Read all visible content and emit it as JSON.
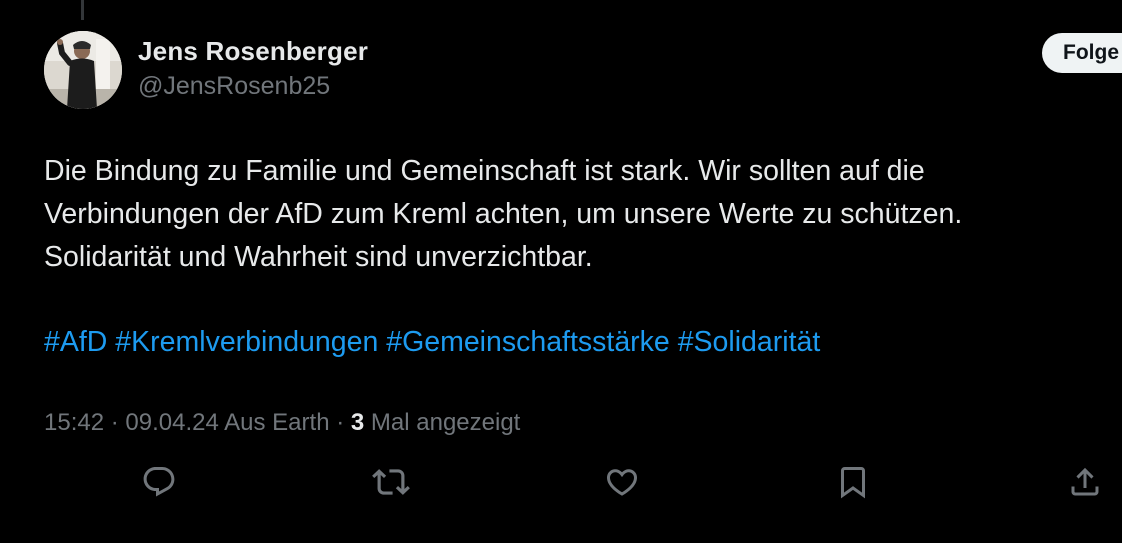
{
  "author": {
    "name": "Jens Rosenberger",
    "handle": "@JensRosenb25"
  },
  "follow_button": {
    "label": "Folge"
  },
  "tweet": {
    "lines": [
      "Die Bindung zu Familie und Gemeinschaft ist stark. Wir sollten auf die",
      "Verbindungen der AfD zum Kreml achten, um unsere Werte zu schützen.",
      "Solidarität und Wahrheit sind unverzichtbar."
    ],
    "hashtags": [
      "#AfD",
      "#Kremlverbindungen",
      "#Gemeinschaftsstärke",
      "#Solidarität"
    ]
  },
  "meta": {
    "time_date_source": "15:42 · 09.04.24 Aus Earth · ",
    "views_count": "3",
    "views_label": " Mal angezeigt"
  },
  "actions": [
    {
      "name": "reply-icon"
    },
    {
      "name": "retweet-icon"
    },
    {
      "name": "like-icon"
    },
    {
      "name": "bookmark-icon"
    },
    {
      "name": "share-icon"
    }
  ],
  "colors": {
    "background": "#000000",
    "text_primary": "#e7e9ea",
    "text_secondary": "#71767b",
    "link": "#1d9bf0",
    "follow_button_bg": "#eff3f4"
  }
}
